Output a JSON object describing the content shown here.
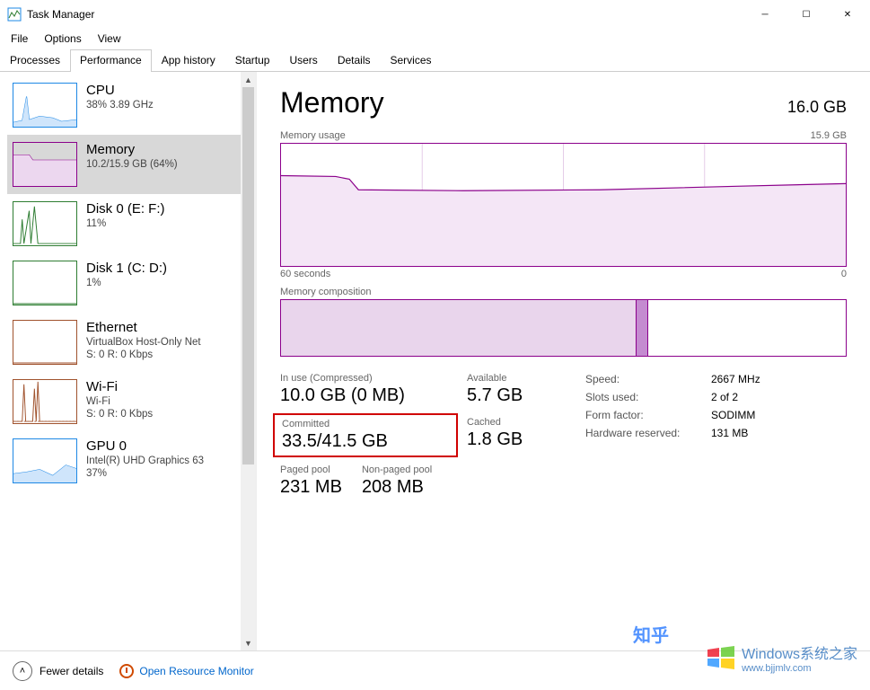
{
  "window": {
    "title": "Task Manager",
    "controls": {
      "min": "─",
      "max": "☐",
      "close": "✕"
    }
  },
  "menu": [
    "File",
    "Options",
    "View"
  ],
  "tabs": [
    "Processes",
    "Performance",
    "App history",
    "Startup",
    "Users",
    "Details",
    "Services"
  ],
  "activeTab": 1,
  "sidebar": {
    "items": [
      {
        "title": "CPU",
        "sub": "38%  3.89 GHz",
        "color": "#1e88e5"
      },
      {
        "title": "Memory",
        "sub": "10.2/15.9 GB (64%)",
        "color": "#8b008b",
        "selected": true
      },
      {
        "title": "Disk 0 (E: F:)",
        "sub": "11%",
        "color": "#2e7d32"
      },
      {
        "title": "Disk 1 (C: D:)",
        "sub": "1%",
        "color": "#2e7d32"
      },
      {
        "title": "Ethernet",
        "sub1": "VirtualBox Host-Only Net",
        "sub2": "S: 0 R: 0 Kbps",
        "color": "#a0522d"
      },
      {
        "title": "Wi-Fi",
        "sub1": "Wi-Fi",
        "sub2": "S: 0 R: 0 Kbps",
        "color": "#a0522d"
      },
      {
        "title": "GPU 0",
        "sub1": "Intel(R) UHD Graphics 63",
        "sub2": "37%",
        "color": "#1e88e5"
      }
    ]
  },
  "memory": {
    "title": "Memory",
    "total": "16.0 GB",
    "usageLabel": "Memory usage",
    "usageMax": "15.9 GB",
    "axisLeft": "60 seconds",
    "axisRight": "0",
    "compLabel": "Memory composition",
    "stats": {
      "inuse": {
        "label": "In use (Compressed)",
        "value": "10.0 GB (0 MB)"
      },
      "avail": {
        "label": "Available",
        "value": "5.7 GB"
      },
      "committed": {
        "label": "Committed",
        "value": "33.5/41.5 GB"
      },
      "cached": {
        "label": "Cached",
        "value": "1.8 GB"
      },
      "paged": {
        "label": "Paged pool",
        "value": "231 MB"
      },
      "nonpaged": {
        "label": "Non-paged pool",
        "value": "208 MB"
      }
    },
    "details": {
      "speed": {
        "label": "Speed:",
        "value": "2667 MHz"
      },
      "slots": {
        "label": "Slots used:",
        "value": "2 of 2"
      },
      "form": {
        "label": "Form factor:",
        "value": "SODIMM"
      },
      "hwres": {
        "label": "Hardware reserved:",
        "value": "131 MB"
      }
    }
  },
  "footer": {
    "fewer": "Fewer details",
    "resmon": "Open Resource Monitor"
  },
  "watermark": {
    "zhihu": "知乎",
    "brand": "Windows系统之家",
    "url": "www.bjjmlv.com"
  },
  "chart_data": {
    "type": "line",
    "title": "Memory usage",
    "x": [
      60,
      55,
      50,
      45,
      40,
      35,
      30,
      25,
      20,
      15,
      10,
      5,
      0
    ],
    "ylim": [
      0,
      15.9
    ],
    "series": [
      {
        "name": "Memory (GB)",
        "values": [
          11.8,
          11.7,
          11.5,
          10.3,
          10.2,
          10.2,
          10.1,
          10.1,
          10.2,
          10.3,
          10.4,
          10.5,
          10.5
        ]
      }
    ],
    "xlabel": "seconds ago",
    "ylabel": "GB"
  }
}
